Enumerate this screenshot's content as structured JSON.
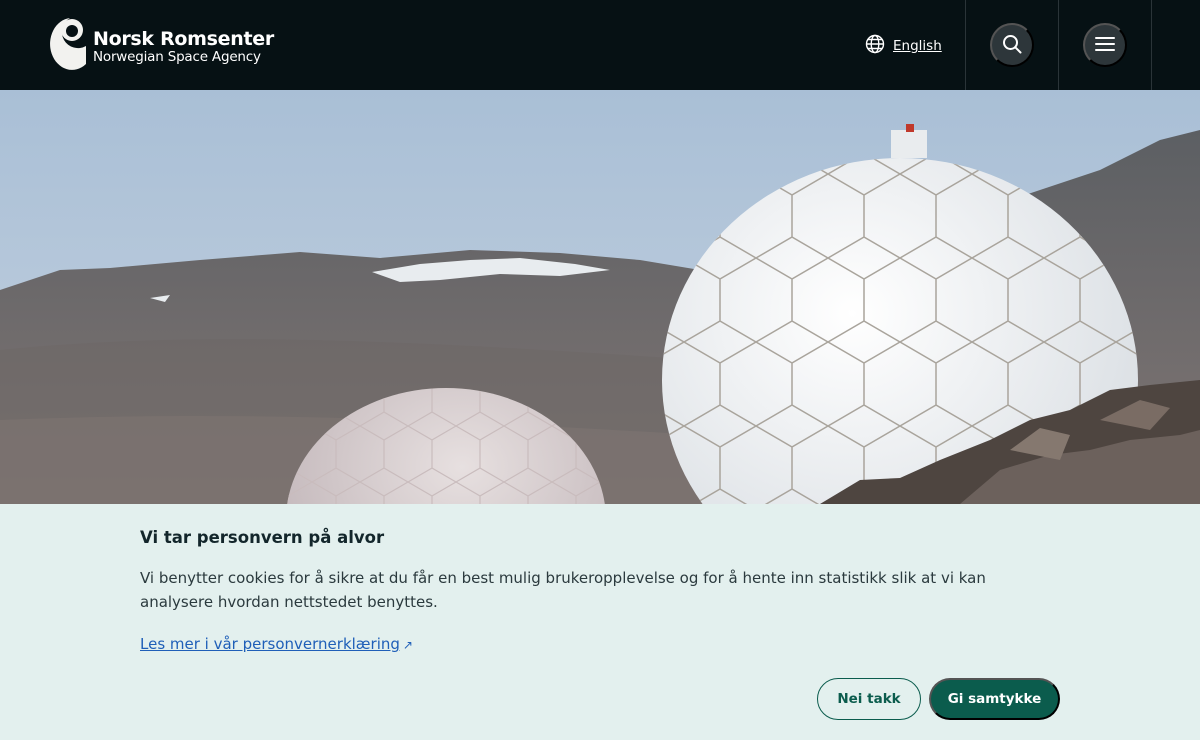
{
  "header": {
    "logo_name": "Norsk Romsenter",
    "logo_sub": "Norwegian Space Agency",
    "language_label": "English",
    "icons": [
      "globe-icon",
      "search-icon",
      "menu-icon"
    ]
  },
  "hero": {
    "image_subject": "radome"
  },
  "cookie_banner": {
    "title": "Vi tar personvern på alvor",
    "body": "Vi benytter cookies for å sikre at du får en best mulig brukeropplevelse og for å hente inn statistikk slik at vi kan analysere hvordan nettstedet benyttes.",
    "link_label": "Les mer i vår personvernerklæring",
    "link_icon": "external-link-icon",
    "decline_label": "Nei takk",
    "accept_label": "Gi samtykke"
  },
  "colors": {
    "header_bg": "#061114",
    "banner_bg": "#e3f0ee",
    "accent": "#0b5c4d",
    "link": "#1f5fb8"
  }
}
